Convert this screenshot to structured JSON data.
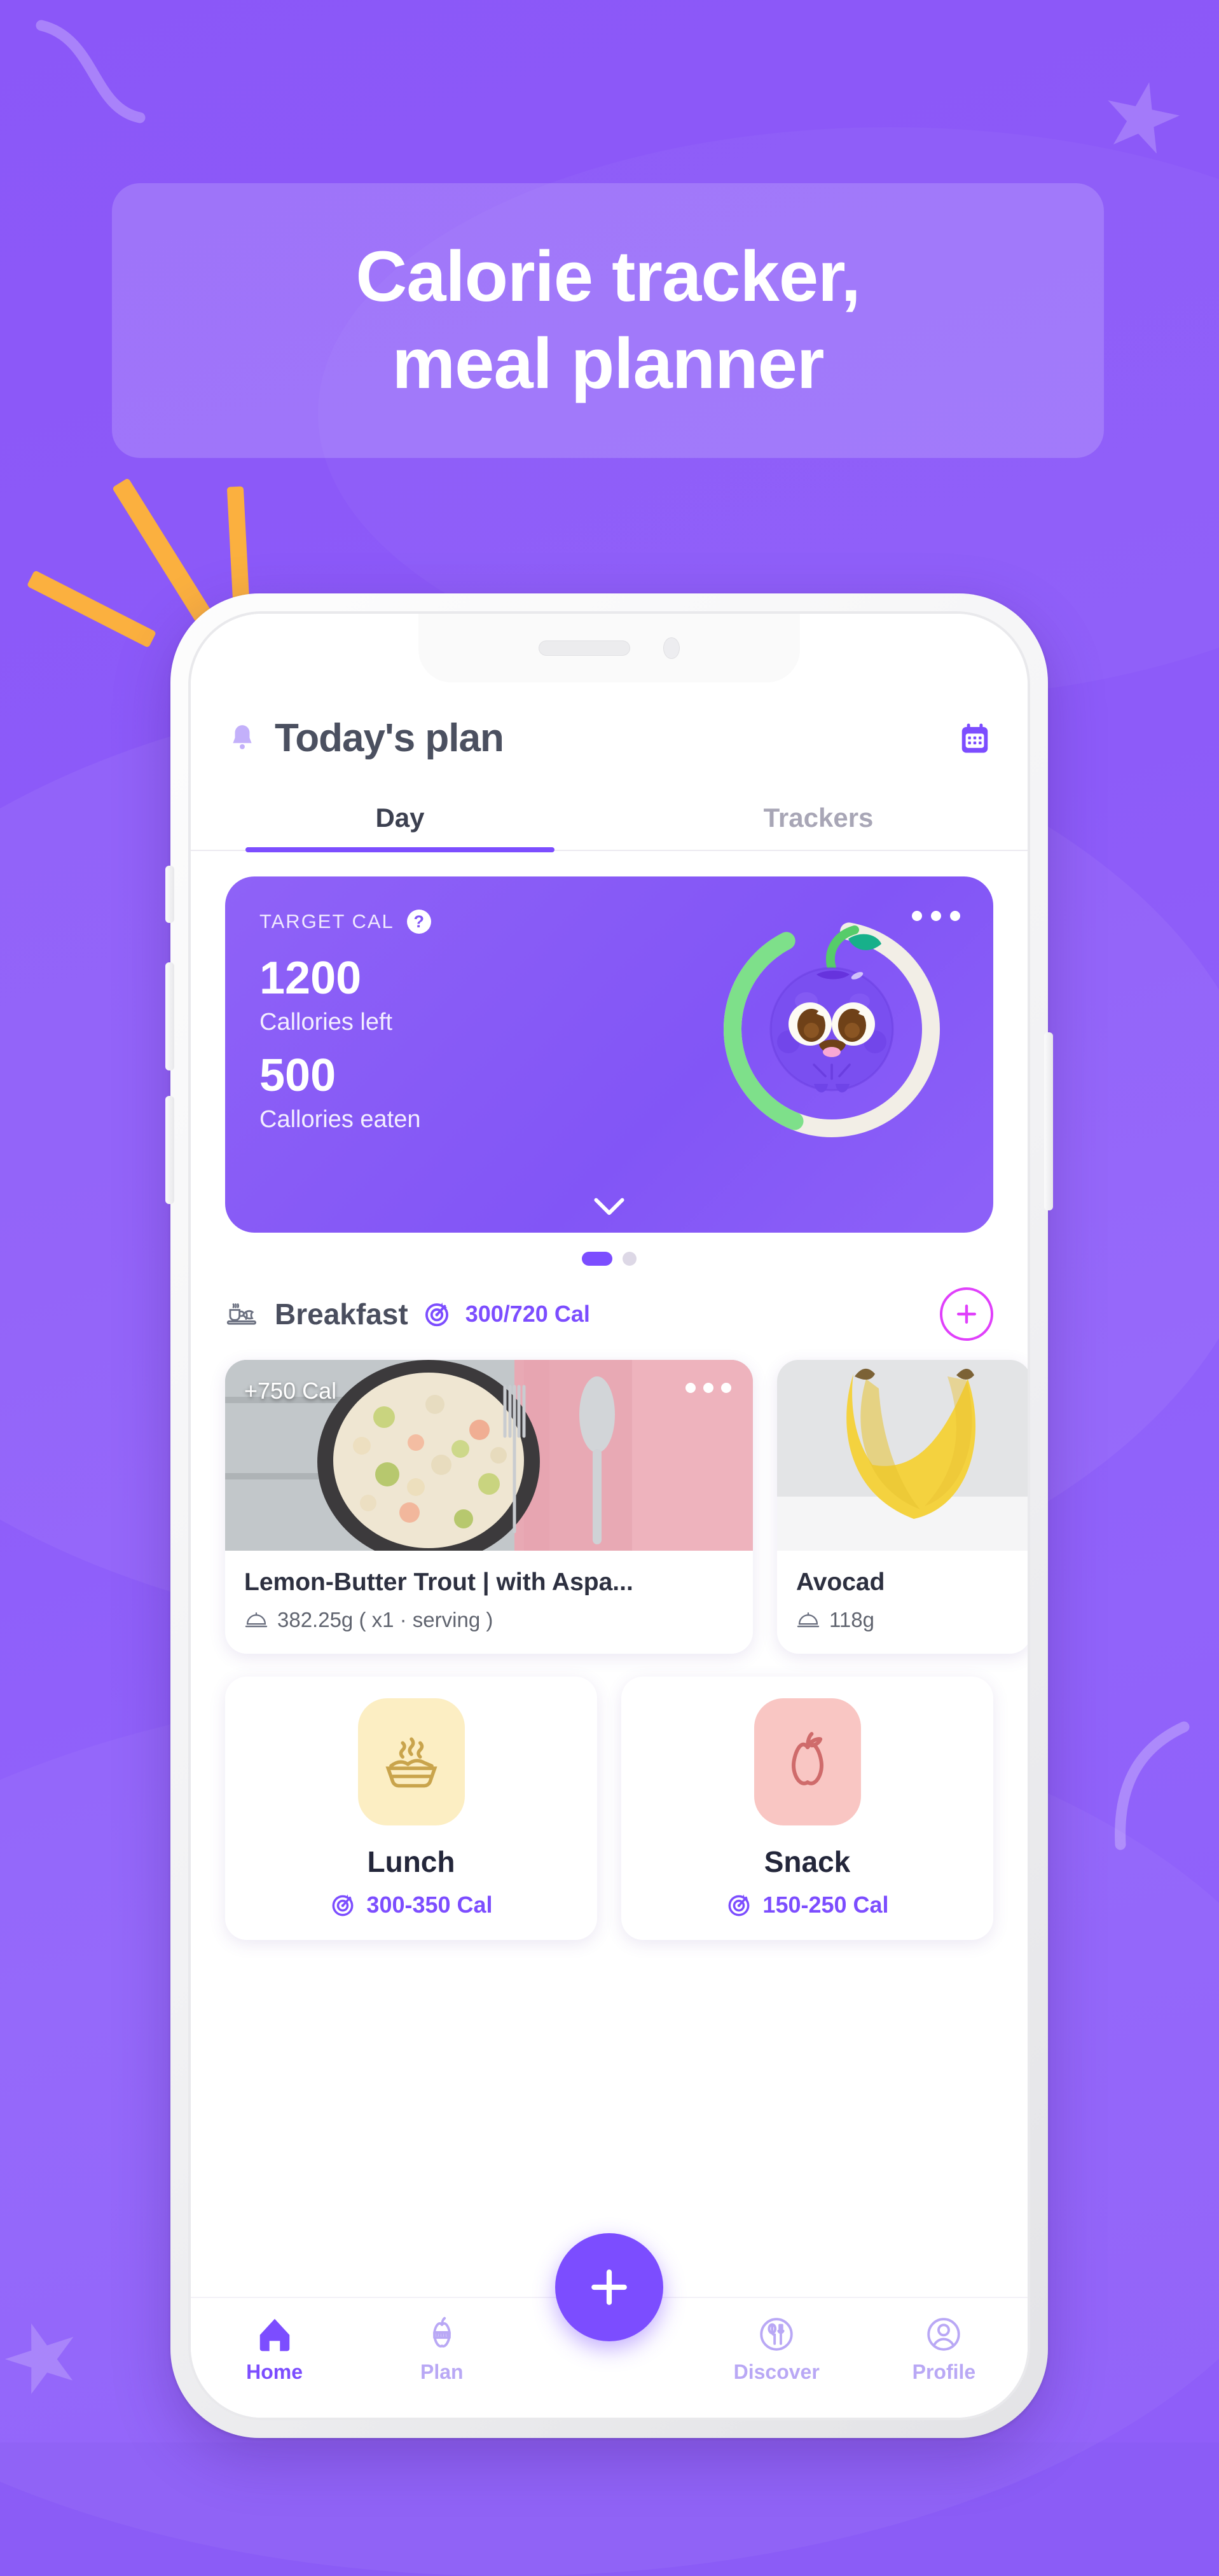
{
  "banner": {
    "headline": "Calorie tracker,\nmeal planner"
  },
  "app": {
    "header": {
      "title": "Today's plan",
      "bell_icon": "bell-icon",
      "calendar_icon": "calendar-icon"
    },
    "tabs": [
      {
        "label": "Day",
        "active": true
      },
      {
        "label": "Trackers",
        "active": false
      }
    ],
    "summary": {
      "target_label": "TARGET CAL",
      "help_icon": "question-mark-icon",
      "calories_left_value": "1200",
      "calories_left_label": "Callories left",
      "calories_eaten_value": "500",
      "calories_eaten_label": "Callories eaten",
      "menu_icon": "more-options-icon",
      "expand_icon": "chevron-down-icon",
      "progress_percent": 42,
      "ring_color_progress": "#7ee08a",
      "ring_color_track": "#f0ece4",
      "card_color": "#8255f6"
    },
    "pager": {
      "total": 2,
      "active_index": 0
    },
    "meal_section": {
      "icon": "coffee-croissant-icon",
      "title": "Breakfast",
      "target_icon": "target-icon",
      "calories": "300/720 Cal",
      "add_icon": "plus-icon",
      "add_color": "#e040fb"
    },
    "food_cards": [
      {
        "kcal_tag": "+750 Cal",
        "name": "Lemon-Butter Trout | with Aspa...",
        "serving_icon": "food-dome-icon",
        "serving": "382.25g ( x1 · serving )",
        "menu_icon": "more-options-icon",
        "photo": "risotto-bowl-photo"
      },
      {
        "kcal_tag": "",
        "name": "Avocad",
        "serving_icon": "food-dome-icon",
        "serving": "118g",
        "menu_icon": "",
        "photo": "bananas-photo"
      }
    ],
    "meal_tiles": [
      {
        "name": "Lunch",
        "icon": "steaming-bowl-icon",
        "tile_color": "#fceec3",
        "target_icon": "target-icon",
        "calories": "300-350 Cal"
      },
      {
        "name": "Snack",
        "icon": "apple-icon",
        "tile_color": "#f9c6c3",
        "target_icon": "target-icon",
        "calories": "150-250 Cal"
      }
    ],
    "fab": {
      "icon": "plus-icon",
      "color": "#7c4dff"
    },
    "bottom_nav": [
      {
        "label": "Home",
        "icon": "home-icon",
        "active": true
      },
      {
        "label": "Plan",
        "icon": "apple-measure-icon",
        "active": false
      },
      {
        "label": "Discover",
        "icon": "fork-spoon-icon",
        "active": false
      },
      {
        "label": "Profile",
        "icon": "person-icon",
        "active": false
      }
    ]
  },
  "theme": {
    "background": "#8b5cf6",
    "accent": "#7c4dff",
    "banner_overlay": "rgba(255,255,255,0.17)",
    "ray_color": "#fbb03f"
  }
}
